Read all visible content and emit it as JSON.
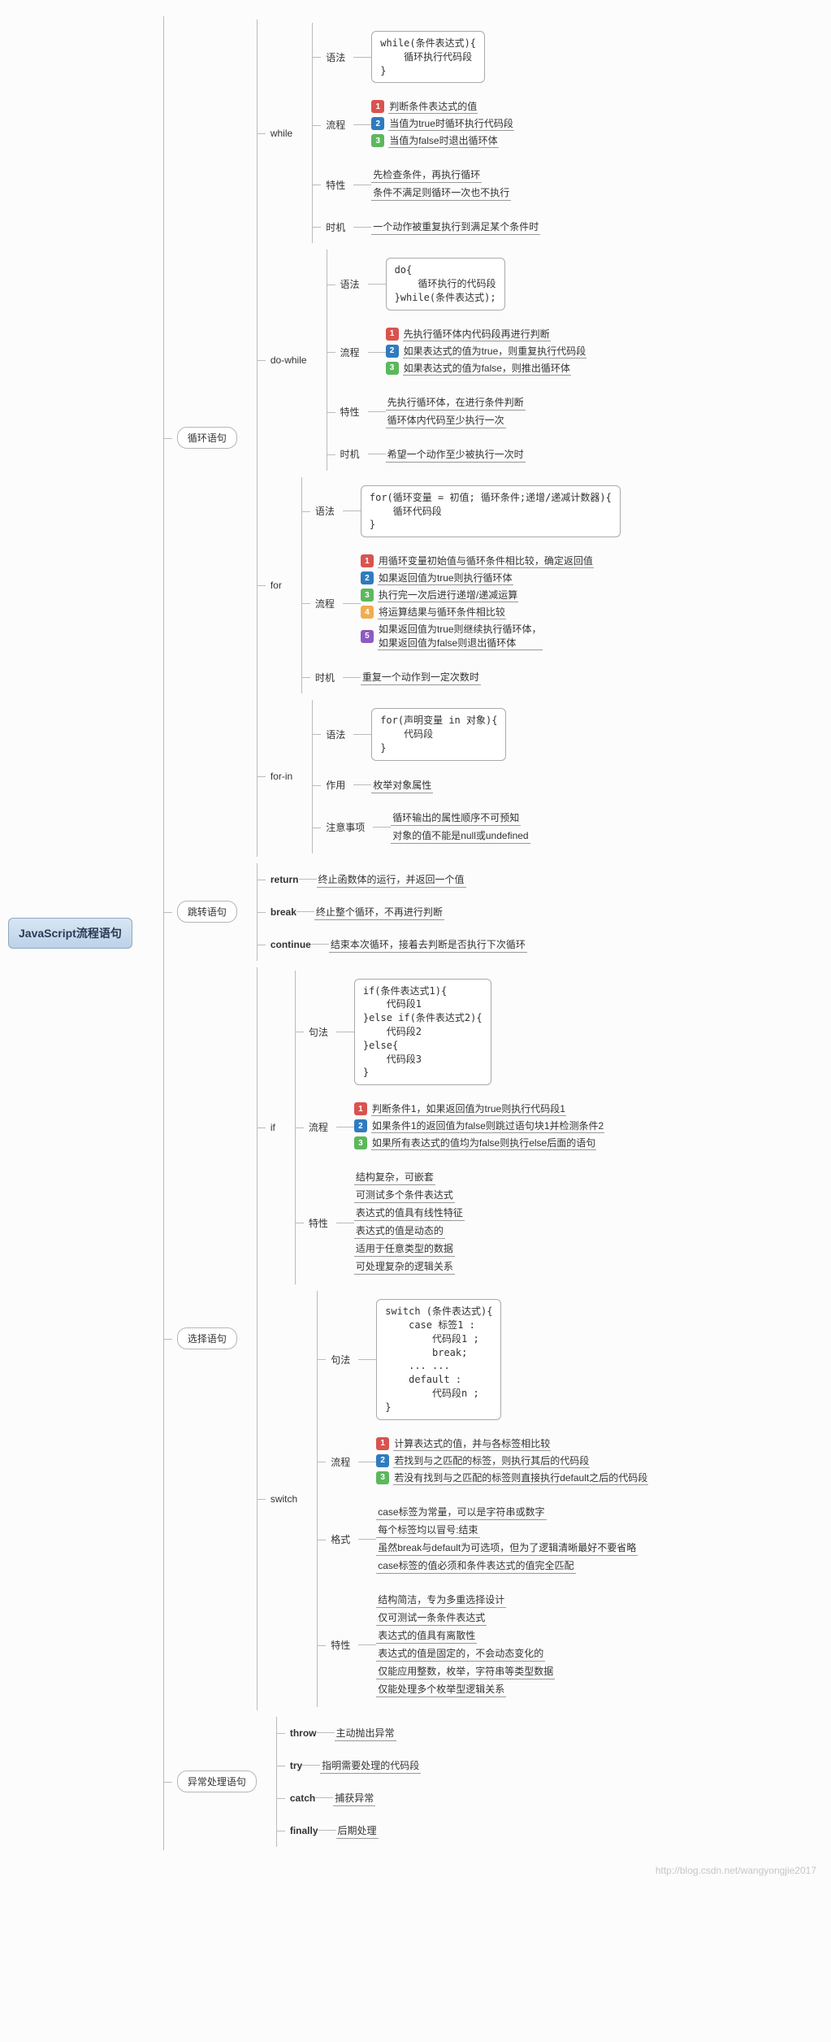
{
  "root": "JavaScript流程语句",
  "footer": "http://blog.csdn.net/wangyongjie2017",
  "loop": {
    "label": "循环语句",
    "while": {
      "label": "while",
      "syntax_label": "语法",
      "syntax": "while(条件表达式){\n    循环执行代码段\n}",
      "process_label": "流程",
      "steps": [
        "判断条件表达式的值",
        "当值为true时循环执行代码段",
        "当值为false时退出循环体"
      ],
      "trait_label": "特性",
      "traits": [
        "先检查条件，再执行循环",
        "条件不满足则循环一次也不执行"
      ],
      "when_label": "时机",
      "when": "一个动作被重复执行到满足某个条件时"
    },
    "dowhile": {
      "label": "do-while",
      "syntax_label": "语法",
      "syntax": "do{\n    循环执行的代码段\n}while(条件表达式);",
      "process_label": "流程",
      "steps": [
        "先执行循环体内代码段再进行判断",
        "如果表达式的值为true，则重复执行代码段",
        "如果表达式的值为false，则推出循环体"
      ],
      "trait_label": "特性",
      "traits": [
        "先执行循环体，在进行条件判断",
        "循环体内代码至少执行一次"
      ],
      "when_label": "时机",
      "when": "希望一个动作至少被执行一次时"
    },
    "for": {
      "label": "for",
      "syntax_label": "语法",
      "syntax": "for(循环变量 = 初值; 循环条件;递增/递减计数器){\n    循环代码段\n}",
      "process_label": "流程",
      "steps": [
        "用循环变量初始值与循环条件相比较，确定返回值",
        "如果返回值为true则执行循环体",
        "执行完一次后进行递增/递减运算",
        "将运算结果与循环条件相比较",
        "如果返回值为true则继续执行循环体，\n如果返回值为false则退出循环体"
      ],
      "when_label": "时机",
      "when": "重复一个动作到一定次数时"
    },
    "forin": {
      "label": "for-in",
      "syntax_label": "语法",
      "syntax": "for(声明变量 in 对象){\n    代码段\n}",
      "use_label": "作用",
      "use": "枚举对象属性",
      "note_label": "注意事项",
      "notes": [
        "循环输出的属性顺序不可预知",
        "对象的值不能是null或undefined"
      ]
    }
  },
  "jump": {
    "label": "跳转语句",
    "return": {
      "label": "return",
      "text": "终止函数体的运行，并返回一个值"
    },
    "break": {
      "label": "break",
      "text": "终止整个循环，不再进行判断"
    },
    "continue": {
      "label": "continue",
      "text": "结束本次循环，接着去判断是否执行下次循环"
    }
  },
  "select": {
    "label": "选择语句",
    "if": {
      "label": "if",
      "syntax_label": "句法",
      "syntax": "if(条件表达式1){\n    代码段1\n}else if(条件表达式2){\n    代码段2\n}else{\n    代码段3\n}",
      "process_label": "流程",
      "steps": [
        "判断条件1，如果返回值为true则执行代码段1",
        "如果条件1的返回值为false则跳过语句块1并检测条件2",
        "如果所有表达式的值均为false则执行else后面的语句"
      ],
      "trait_label": "特性",
      "traits": [
        "结构复杂，可嵌套",
        "可测试多个条件表达式",
        "表达式的值具有线性特征",
        "表达式的值是动态的",
        "适用于任意类型的数据",
        "可处理复杂的逻辑关系"
      ]
    },
    "switch": {
      "label": "switch",
      "syntax_label": "句法",
      "syntax": "switch (条件表达式){\n    case 标签1 :\n        代码段1 ;\n        break;\n    ... ...\n    default :\n        代码段n ;\n}",
      "process_label": "流程",
      "steps": [
        "计算表达式的值，并与各标签相比较",
        "若找到与之匹配的标签，则执行其后的代码段",
        "若没有找到与之匹配的标签则直接执行default之后的代码段"
      ],
      "format_label": "格式",
      "formats": [
        "case标签为常量，可以是字符串或数字",
        "每个标签均以冒号:结束",
        "虽然break与default为可选项，但为了逻辑清晰最好不要省略",
        "case标签的值必须和条件表达式的值完全匹配"
      ],
      "trait_label": "特性",
      "traits": [
        "结构简洁，专为多重选择设计",
        "仅可测试一条条件表达式",
        "表达式的值具有离散性",
        "表达式的值是固定的，不会动态变化的",
        "仅能应用整数，枚举，字符串等类型数据",
        "仅能处理多个枚举型逻辑关系"
      ]
    }
  },
  "exception": {
    "label": "异常处理语句",
    "throw": {
      "label": "throw",
      "text": "主动抛出异常"
    },
    "try": {
      "label": "try",
      "text": "指明需要处理的代码段"
    },
    "catch": {
      "label": "catch",
      "text": "捕获异常"
    },
    "finally": {
      "label": "finally",
      "text": "后期处理"
    }
  }
}
